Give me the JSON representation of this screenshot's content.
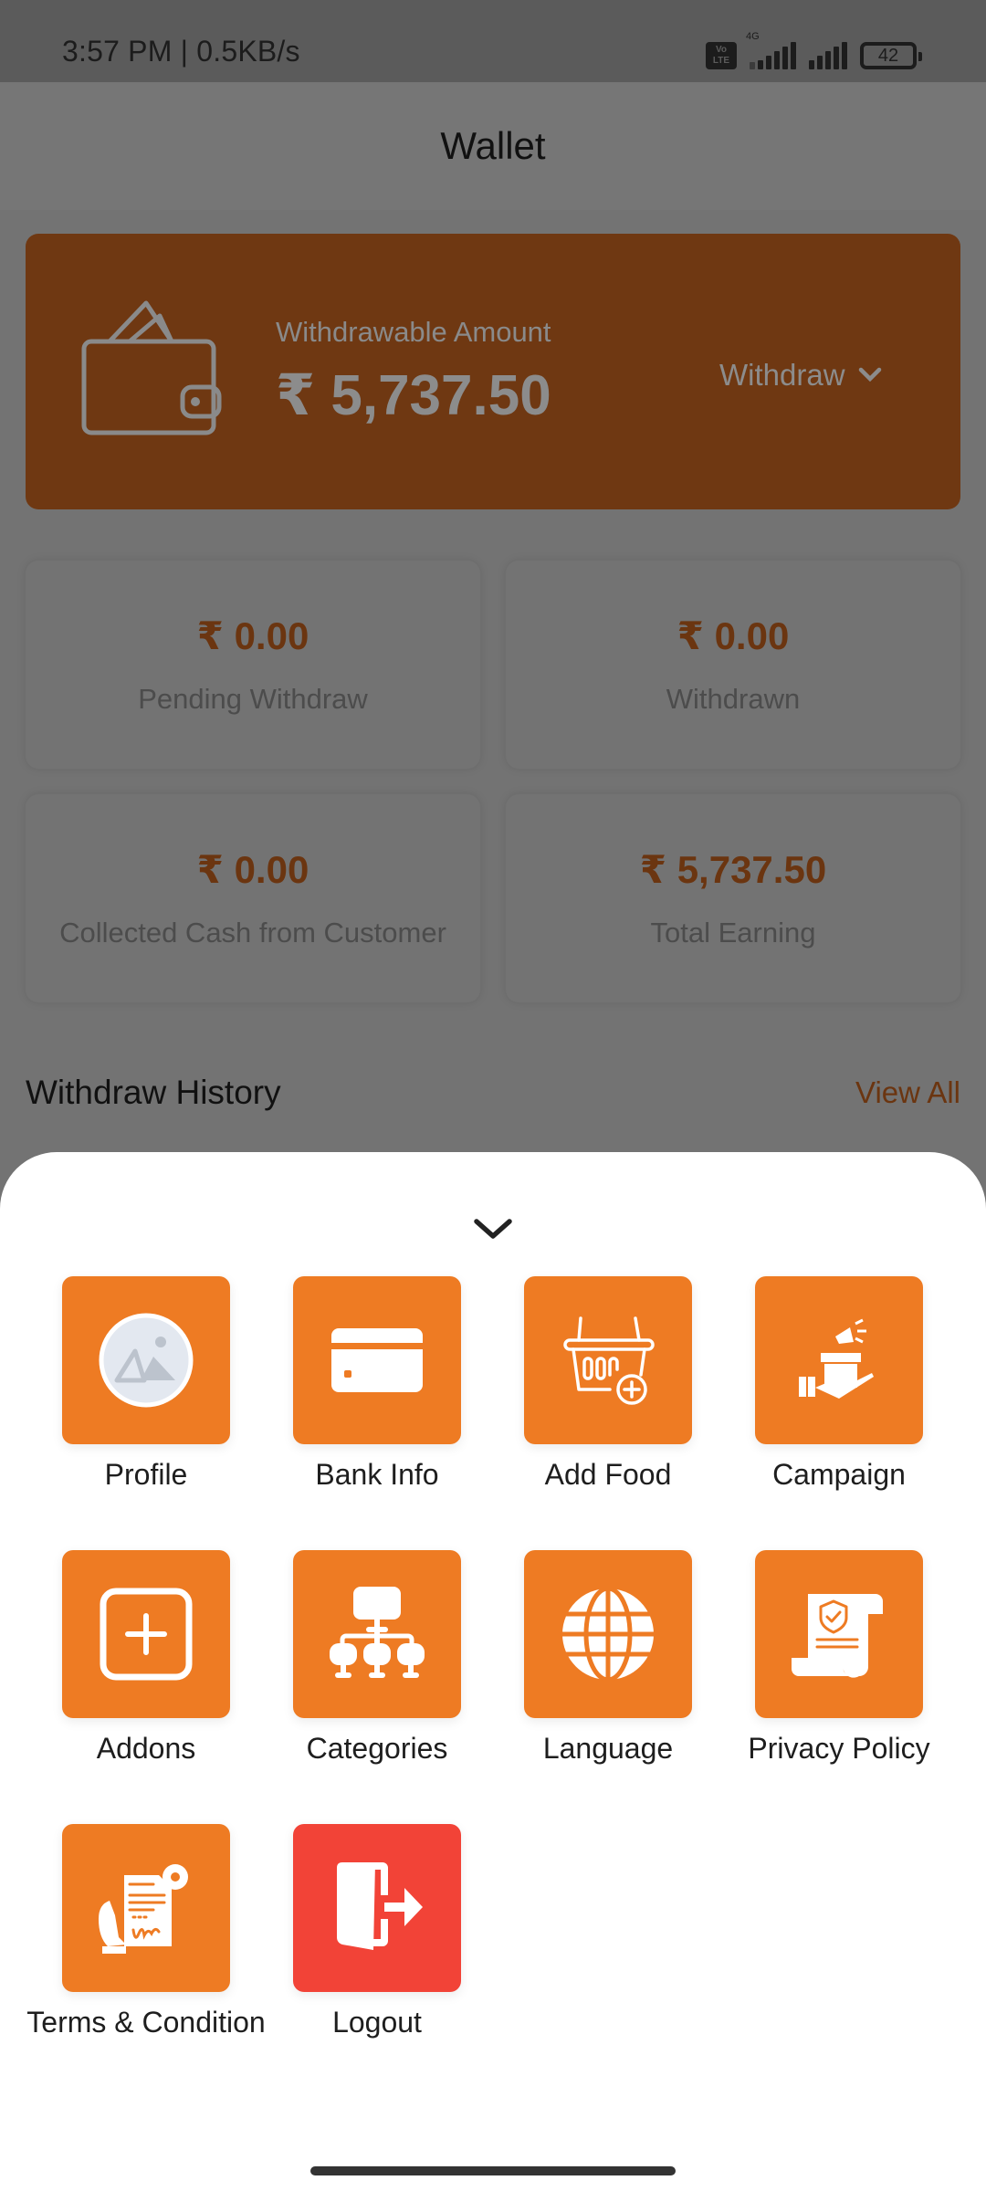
{
  "status_bar": {
    "time_speed": "3:57 PM | 0.5KB/s",
    "volte_label": "Vo LTE",
    "network_type": "4G",
    "battery_level": "42"
  },
  "app_bar": {
    "title": "Wallet"
  },
  "wallet_card": {
    "label": "Withdrawable Amount",
    "amount": "₹ 5,737.50",
    "withdraw_label": "Withdraw",
    "icon": "wallet-icon",
    "background_color": "#ef7d22"
  },
  "stats": [
    {
      "value": "₹ 0.00",
      "label": "Pending Withdraw"
    },
    {
      "value": "₹ 0.00",
      "label": "Withdrawn"
    },
    {
      "value": "₹ 0.00",
      "label": "Collected Cash from Customer"
    },
    {
      "value": "₹ 5,737.50",
      "label": "Total Earning"
    }
  ],
  "withdraw_history": {
    "title": "Withdraw History",
    "view_all_label": "View All"
  },
  "menu_sheet": {
    "collapse_icon": "chevron-down-icon",
    "accent_color": "#ee7b23",
    "danger_color": "#f24337",
    "items": [
      {
        "label": "Profile",
        "icon": "profile-image-icon"
      },
      {
        "label": "Bank Info",
        "icon": "credit-card-icon"
      },
      {
        "label": "Add Food",
        "icon": "basket-add-icon"
      },
      {
        "label": "Campaign",
        "icon": "campaign-icon"
      },
      {
        "label": "Addons",
        "icon": "add-square-icon"
      },
      {
        "label": "Categories",
        "icon": "hierarchy-icon"
      },
      {
        "label": "Language",
        "icon": "globe-icon"
      },
      {
        "label": "Privacy Policy",
        "icon": "privacy-policy-icon"
      },
      {
        "label": "Terms & Condition",
        "icon": "terms-document-icon"
      },
      {
        "label": "Logout",
        "icon": "logout-door-icon"
      }
    ]
  }
}
